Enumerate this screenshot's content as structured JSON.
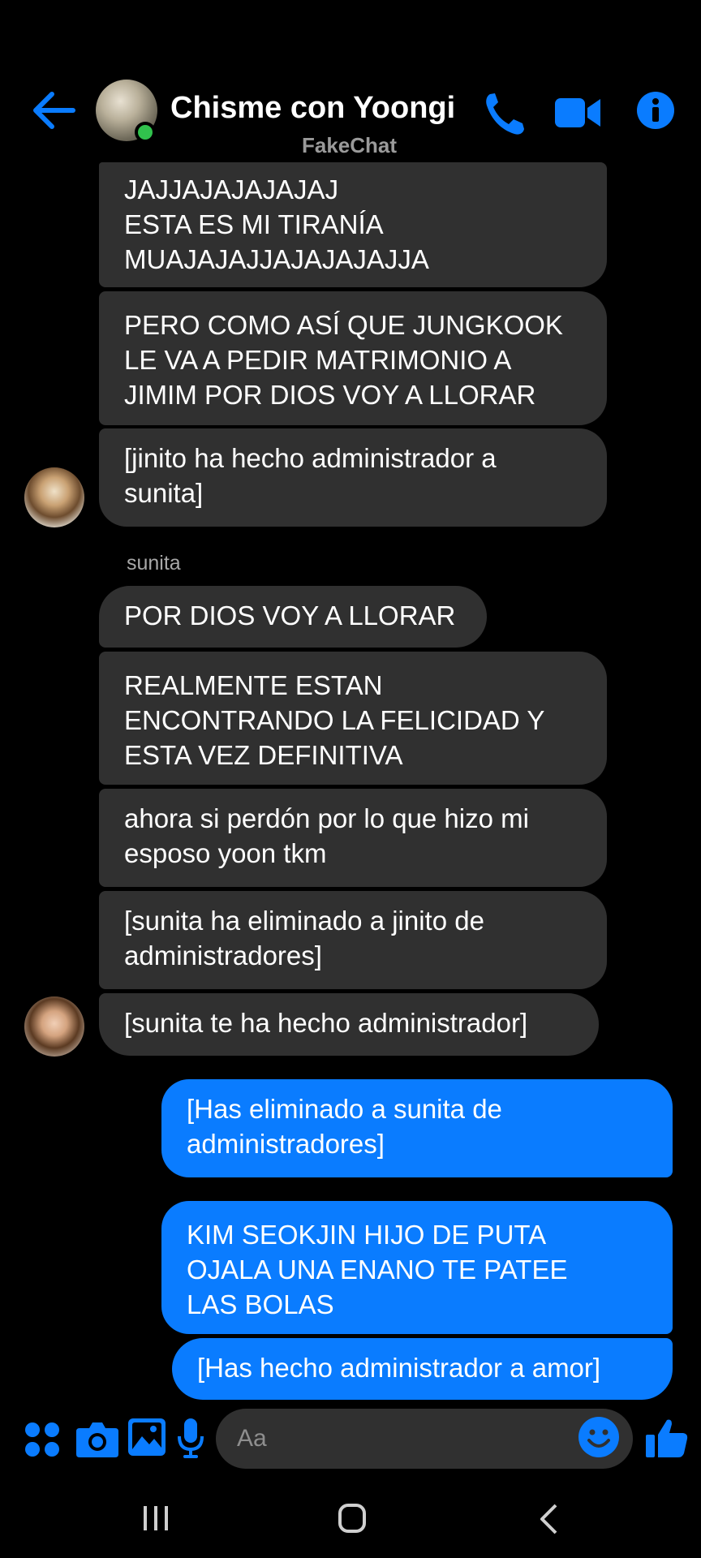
{
  "header": {
    "title": "Chisme con Yoongi",
    "watermark": "FakeChat"
  },
  "sender": "sunita",
  "messages": {
    "m1": [
      "JAJJAJAJAJAJAJ",
      "ESTA ES MI TIRANÍA",
      "MUAJAJAJJAJAJAJAJJA"
    ],
    "m2": [
      "PERO COMO ASÍ QUE JUNGKOOK",
      "LE VA A PEDIR MATRIMONIO A",
      "JIMIM POR DIOS VOY A LLORAR"
    ],
    "m3": [
      "[jinito ha hecho administrador a",
      "sunita]"
    ],
    "m4": [
      "POR DIOS VOY A LLORAR"
    ],
    "m5": [
      "REALMENTE ESTAN",
      "ENCONTRANDO LA FELICIDAD Y",
      "ESTA VEZ DEFINITIVA"
    ],
    "m6": [
      "ahora si perdón por lo que hizo mi",
      "esposo yoon tkm"
    ],
    "m7": [
      "[sunita ha eliminado a jinito de",
      "administradores]"
    ],
    "m8": [
      "[sunita te ha hecho administrador]"
    ],
    "m9": [
      "[Has eliminado a sunita de",
      "administradores]"
    ],
    "m10": [
      "KIM SEOKJIN HIJO DE PUTA",
      "OJALA UNA ENANO TE PATEE",
      "LAS BOLAS"
    ],
    "m11": [
      "[Has hecho administrador a amor]"
    ]
  },
  "composer": {
    "placeholder": "Aa"
  },
  "colors": {
    "accent": "#0a7cff",
    "incoming_bubble": "#303030",
    "online": "#31c24d"
  },
  "icons": [
    "back-arrow-icon",
    "phone-icon",
    "video-camera-icon",
    "info-icon",
    "apps-icon",
    "camera-icon",
    "gallery-icon",
    "microphone-icon",
    "emoji-icon",
    "thumbs-up-icon",
    "recent-apps-icon",
    "home-icon",
    "nav-back-icon"
  ]
}
